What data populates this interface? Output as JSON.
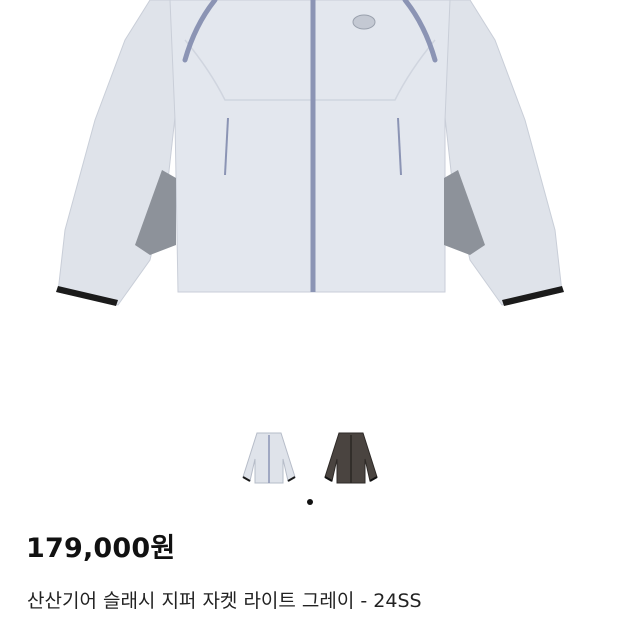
{
  "product": {
    "price": "179,000원",
    "title": "산산기어 슬래시 지퍼 자켓 라이트 그레이 - 24SS"
  },
  "gallery": {
    "thumbnails": [
      {
        "alt": "light-grey-jacket",
        "color": "#dfe3ea"
      },
      {
        "alt": "brown-jacket",
        "color": "#4a4440"
      }
    ],
    "active_index": 0
  },
  "colors": {
    "jacket_body": "#dfe3ea",
    "jacket_trim": "#8b94b4",
    "jacket_panel": "#8d929a",
    "cuff": "#1b1b1b"
  }
}
